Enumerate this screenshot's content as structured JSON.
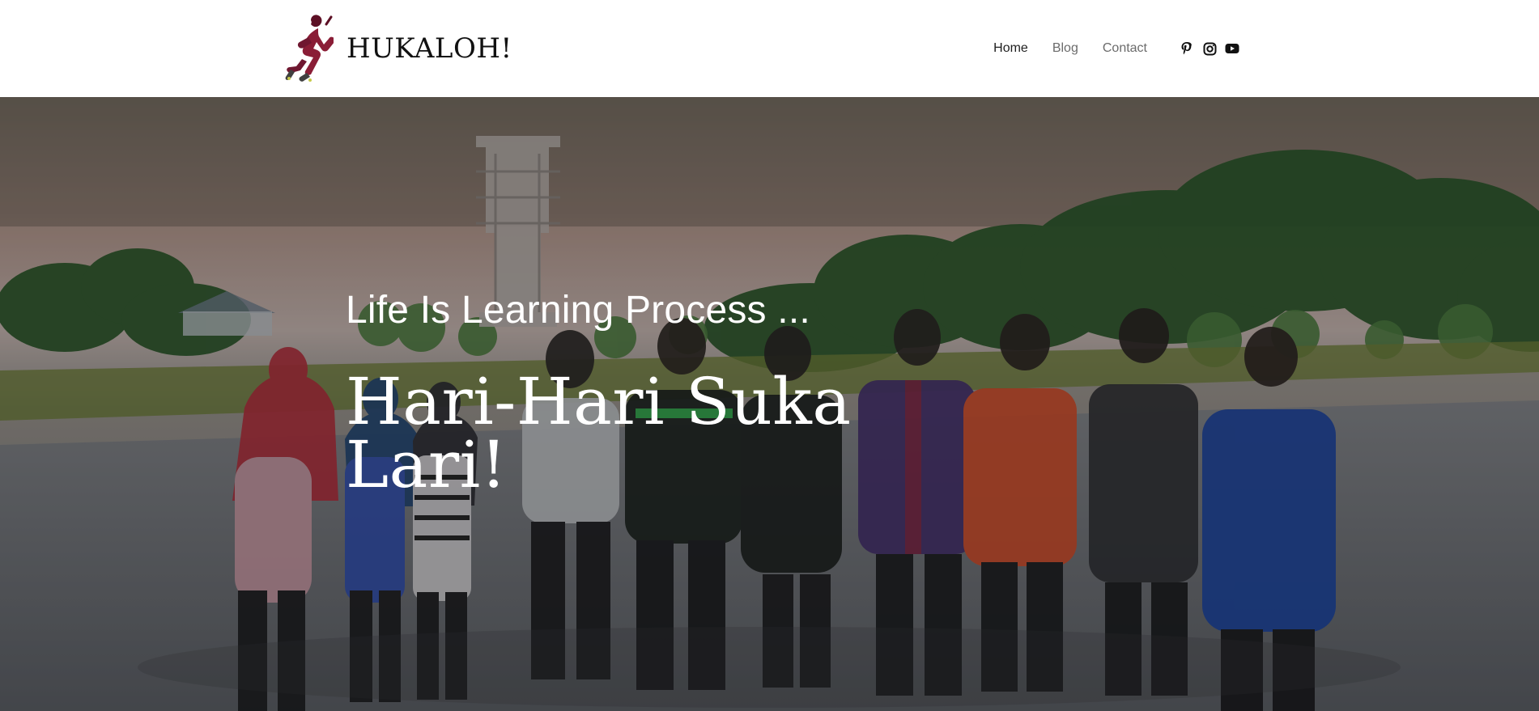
{
  "site": {
    "title": "HUKALOH!"
  },
  "nav": {
    "items": [
      {
        "label": "Home",
        "active": true
      },
      {
        "label": "Blog",
        "active": false
      },
      {
        "label": "Contact",
        "active": false
      }
    ]
  },
  "social": [
    {
      "name": "pinterest-icon"
    },
    {
      "name": "instagram-icon"
    },
    {
      "name": "youtube-icon"
    }
  ],
  "hero": {
    "subtitle": "Life Is Learning Process ...",
    "title": "Hari-Hari Suka Lari!"
  },
  "colors": {
    "logo": "#8a1d36",
    "overlay": "#000000",
    "text": "#ffffff"
  }
}
